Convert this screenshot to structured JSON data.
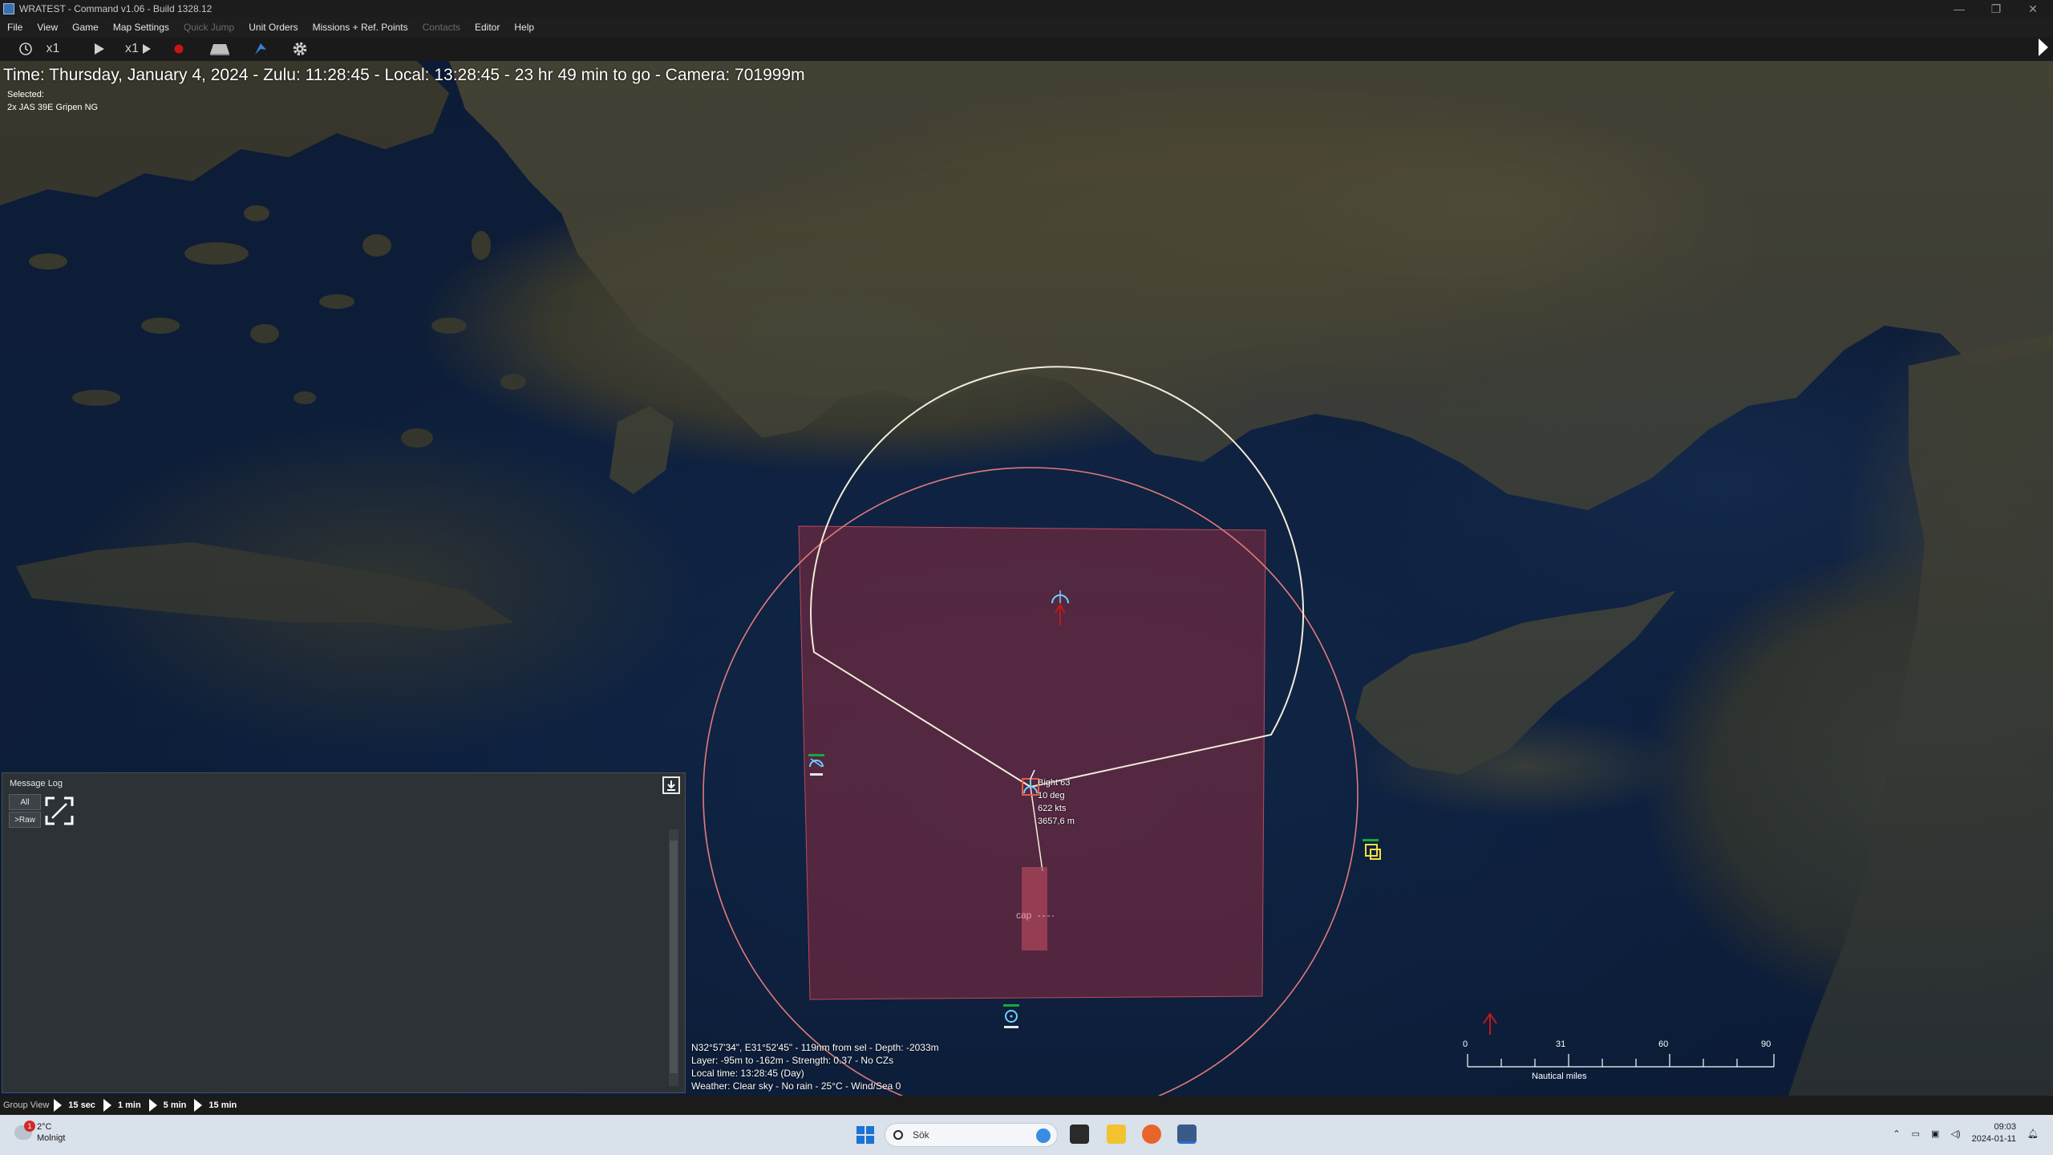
{
  "window": {
    "title": "WRATEST - Command v1.06 - Build 1328.12",
    "controls": [
      "—",
      "❐",
      "✕"
    ]
  },
  "menu": {
    "items": [
      {
        "label": "File",
        "enabled": true
      },
      {
        "label": "View",
        "enabled": true
      },
      {
        "label": "Game",
        "enabled": true
      },
      {
        "label": "Map Settings",
        "enabled": true
      },
      {
        "label": "Quick Jump",
        "enabled": false
      },
      {
        "label": "Unit Orders",
        "enabled": true
      },
      {
        "label": "Missions + Ref. Points",
        "enabled": true
      },
      {
        "label": "Contacts",
        "enabled": false
      },
      {
        "label": "Editor",
        "enabled": true
      },
      {
        "label": "Help",
        "enabled": true
      }
    ]
  },
  "toolbar": {
    "time_compression_label": "x1",
    "play_speed_label": "x1"
  },
  "hud": {
    "status_line": "Time: Thursday, January 4, 2024 - Zulu: 11:28:45 - Local: 13:28:45 - 23 hr 49 min to go -  Camera: 701999m",
    "selected_label": "Selected:",
    "selected_value": "2x JAS 39E Gripen NG"
  },
  "map": {
    "unit_label": [
      "Bight 63",
      "10 deg",
      "622 kts",
      "3657,6 m"
    ],
    "mission_label": "cap",
    "colors": {
      "cap_area": "#7a2a3a",
      "range_ring_white": "#f2ecd8",
      "range_ring_red": "#e07a7a",
      "friendly": "#6fd0ff",
      "unknown": "#f0e040",
      "hostile_marker": "#c01818"
    }
  },
  "cursor_info": {
    "line1": "N32°57'34\", E31°52'45\" - 119nm from sel - Depth: -2033m",
    "line2": "Layer: -95m to -162m - Strength: 0.37 - No CZs",
    "line3": "Local time: 13:28:45 (Day)",
    "line4": "Weather: Clear sky - No rain - 25°C - Wind/Sea 0"
  },
  "scale_bar": {
    "ticks": [
      "0",
      "31",
      "60",
      "90"
    ],
    "unit": "Nautical miles"
  },
  "message_log": {
    "title": "Message Log",
    "btn_all": "All",
    "btn_raw": ">Raw"
  },
  "group_view": {
    "label": "Group View",
    "buttons": [
      "15 sec",
      "1 min",
      "5 min",
      "15 min"
    ]
  },
  "taskbar": {
    "weather_temp": "2°C",
    "weather_desc": "Molnigt",
    "weather_badge": "1",
    "search_placeholder": "Sök",
    "time": "09:03",
    "date": "2024-01-11"
  }
}
